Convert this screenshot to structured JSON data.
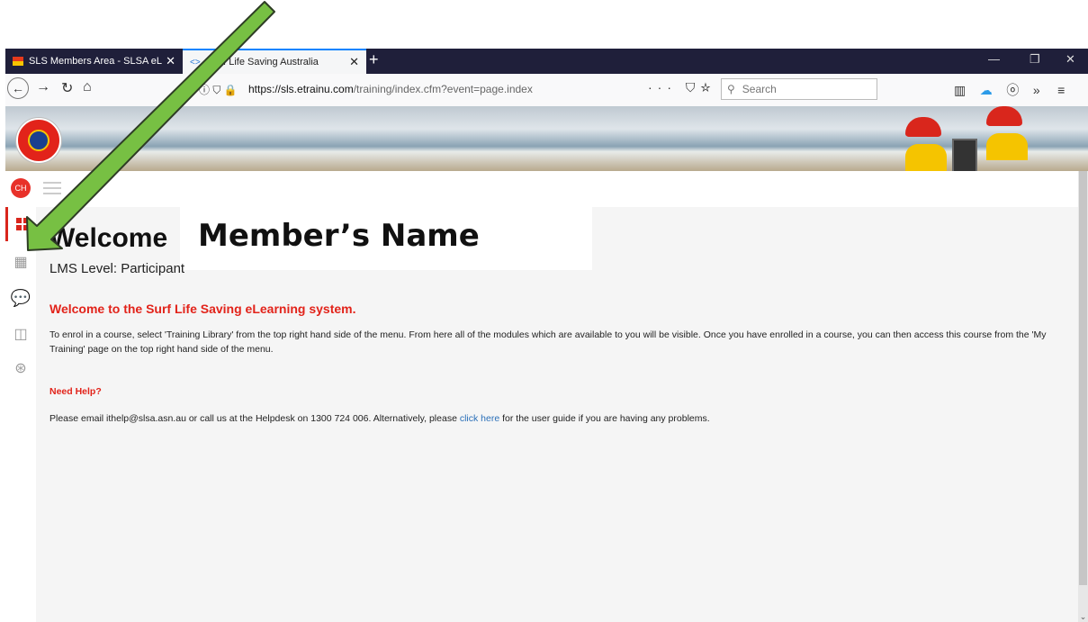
{
  "browser": {
    "tabs": [
      {
        "title": "SLS Members Area - SLSA eLea"
      },
      {
        "title": "Surf Life Saving Australia"
      }
    ],
    "new_tab": "+",
    "url_domain": "https://sls.etrainu.com",
    "url_path": "/training/index.cfm?event=page.index",
    "search_placeholder": "Search",
    "overflow": "···"
  },
  "user": {
    "initials": "CH"
  },
  "page": {
    "welcome": "Welcome",
    "member_name": "Member’s Name",
    "lms_level": "LMS Level: Participant",
    "intro_heading": "Welcome to the Surf Life Saving eLearning system.",
    "intro_text": "To enrol in a course, select 'Training Library' from the top right hand side of the menu. From here all of the modules which are available to you will be visible. Once you have enrolled in a course, you can then access this course from the 'My Training' page on the top right hand side of the menu.",
    "help_heading": "Need Help?",
    "help_text_before": "Please email ithelp@slsa.asn.au or call us at the Helpdesk on 1300 724 006. Alternatively, please ",
    "help_link": "click here",
    "help_text_after": " for the user guide if you are having any problems."
  },
  "colors": {
    "brand_red": "#e2231a",
    "annotation_arrow": "#77c043",
    "link": "#2a6fb8"
  },
  "icons": [
    "dashboard-icon",
    "training-library-icon",
    "chat-icon",
    "book-icon",
    "help-lifebuoy-icon"
  ]
}
